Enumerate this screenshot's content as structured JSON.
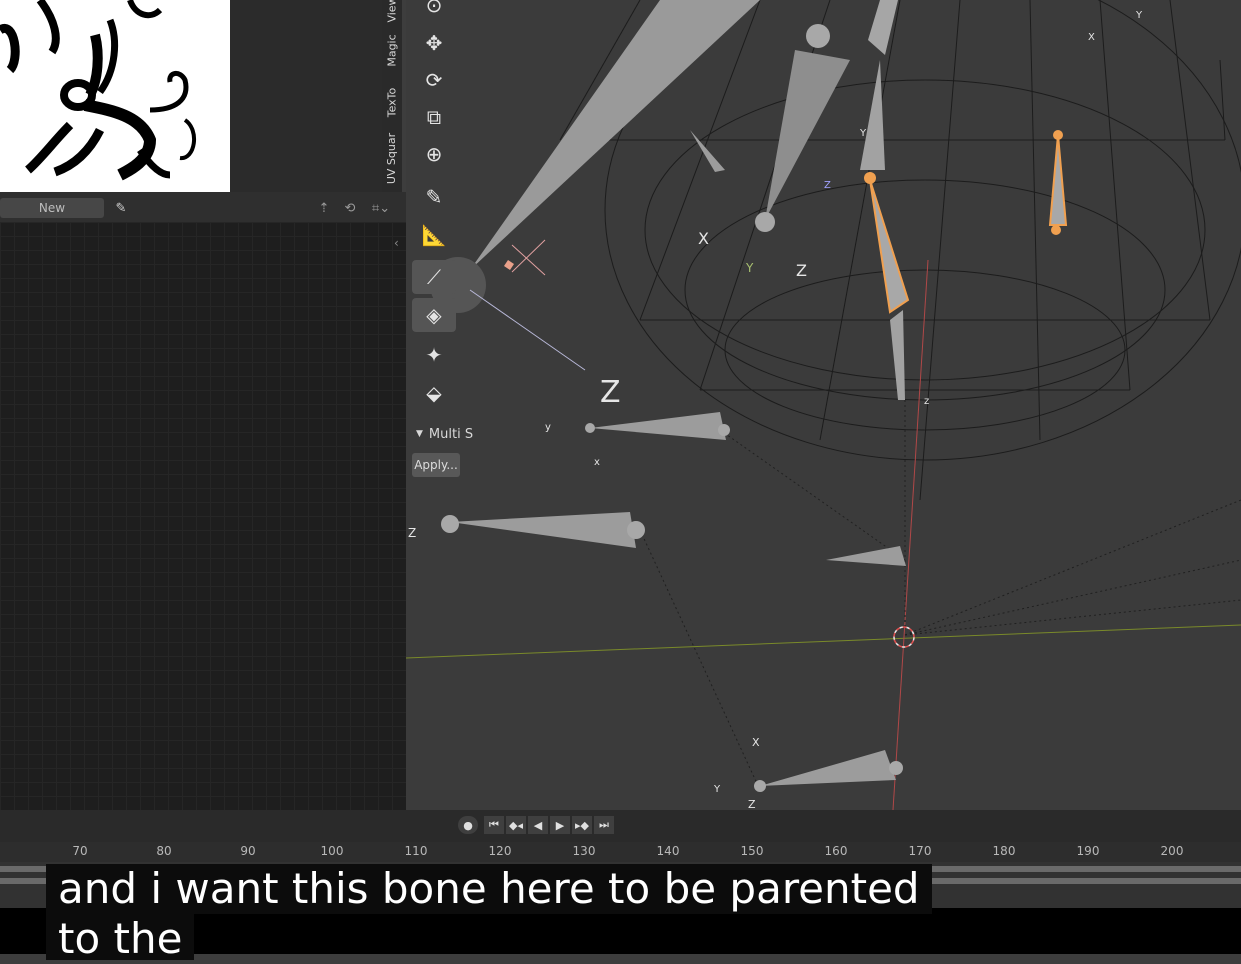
{
  "sidebar": {
    "tabs": [
      "View",
      "Magic",
      "TexTo",
      "UV Squar"
    ]
  },
  "image_editor": {
    "new_label": "New"
  },
  "toolbar": {
    "panel_title": "Multi S",
    "apply_label": "Apply..."
  },
  "viewport": {
    "axis_labels": {
      "x1": "X",
      "z1": "Z",
      "y1": "Y",
      "x2": "X",
      "z2": "Z",
      "y2": "Y",
      "x3": "x",
      "z3": "z",
      "y3": "y",
      "z4": "Z",
      "z5": "Z",
      "y5": "Y",
      "x6": "X",
      "y6": "Y",
      "z6": "Z"
    },
    "colors": {
      "selected_bone": "#f0a050",
      "x_axis_line": "#e05050",
      "y_axis_line": "#8aa030"
    }
  },
  "timeline": {
    "ticks": [
      "70",
      "80",
      "90",
      "100",
      "110",
      "120",
      "130",
      "140",
      "150",
      "160",
      "170",
      "180",
      "190",
      "200"
    ],
    "playback": [
      "record-icon",
      "jump-start-icon",
      "prev-keyframe-icon",
      "play-reverse-icon",
      "play-icon",
      "next-keyframe-icon",
      "jump-end-icon"
    ]
  },
  "caption": {
    "line1": "and i want this bone here to be parented",
    "line2": "to the"
  }
}
